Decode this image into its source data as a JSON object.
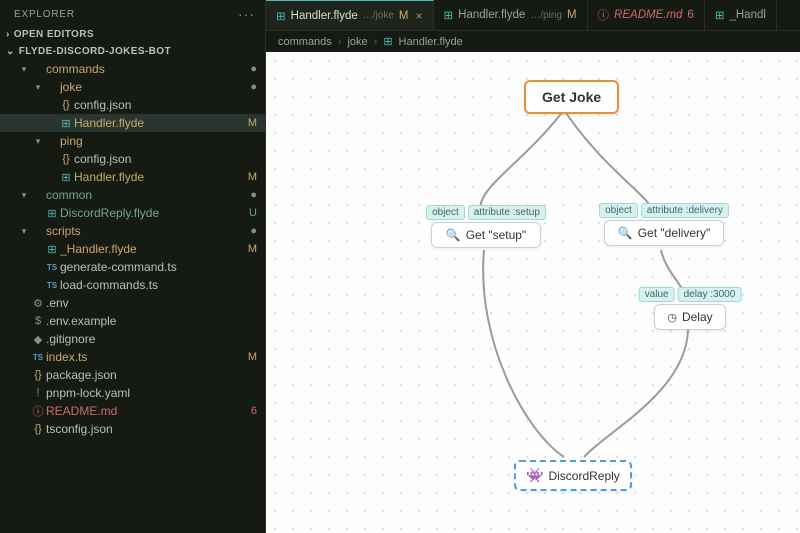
{
  "explorer": {
    "title": "EXPLORER",
    "openEditors": "OPEN EDITORS",
    "project": "FLYDE-DISCORD-JOKES-BOT",
    "tree": [
      {
        "ind": 1,
        "chev": "▾",
        "icon": "",
        "label": "commands",
        "cls": "folder-c",
        "badge": "●",
        "badgeCls": "gray",
        "sel": false
      },
      {
        "ind": 2,
        "chev": "▾",
        "icon": "",
        "label": "joke",
        "cls": "folder-c",
        "badge": "●",
        "badgeCls": "gray",
        "sel": false
      },
      {
        "ind": 3,
        "chev": "",
        "icon": "{}",
        "iconCls": "yellow",
        "label": "config.json",
        "cls": "",
        "badge": "",
        "sel": false
      },
      {
        "ind": 3,
        "chev": "",
        "icon": "⊞",
        "iconCls": "teal",
        "label": "Handler.flyde",
        "cls": "git-m",
        "badge": "M",
        "badgeCls": "git-m",
        "sel": true
      },
      {
        "ind": 2,
        "chev": "▾",
        "icon": "",
        "label": "ping",
        "cls": "folder-c",
        "badge": "",
        "sel": false
      },
      {
        "ind": 3,
        "chev": "",
        "icon": "{}",
        "iconCls": "yellow",
        "label": "config.json",
        "cls": "",
        "badge": "",
        "sel": false
      },
      {
        "ind": 3,
        "chev": "",
        "icon": "⊞",
        "iconCls": "teal",
        "label": "Handler.flyde",
        "cls": "git-m",
        "badge": "M",
        "badgeCls": "git-m",
        "sel": false
      },
      {
        "ind": 1,
        "chev": "▾",
        "icon": "",
        "label": "common",
        "cls": "git-u",
        "badge": "●",
        "badgeCls": "gray",
        "sel": false
      },
      {
        "ind": 2,
        "chev": "",
        "icon": "⊞",
        "iconCls": "teal",
        "label": "DiscordReply.flyde",
        "cls": "git-u",
        "badge": "U",
        "badgeCls": "git-u",
        "sel": false
      },
      {
        "ind": 1,
        "chev": "▾",
        "icon": "",
        "label": "scripts",
        "cls": "folder-c",
        "badge": "●",
        "badgeCls": "gray",
        "sel": false
      },
      {
        "ind": 2,
        "chev": "",
        "icon": "⊞",
        "iconCls": "teal",
        "label": "_Handler.flyde",
        "cls": "git-m",
        "badge": "M",
        "badgeCls": "git-m",
        "sel": false
      },
      {
        "ind": 2,
        "chev": "",
        "icon": "TS",
        "iconCls": "blue",
        "label": "generate-command.ts",
        "cls": "",
        "badge": "",
        "sel": false
      },
      {
        "ind": 2,
        "chev": "",
        "icon": "TS",
        "iconCls": "blue",
        "label": "load-commands.ts",
        "cls": "",
        "badge": "",
        "sel": false
      },
      {
        "ind": 1,
        "chev": "",
        "icon": "⚙",
        "iconCls": "gray",
        "label": ".env",
        "cls": "",
        "badge": "",
        "sel": false
      },
      {
        "ind": 1,
        "chev": "",
        "icon": "$",
        "iconCls": "gray",
        "label": ".env.example",
        "cls": "",
        "badge": "",
        "sel": false
      },
      {
        "ind": 1,
        "chev": "",
        "icon": "◆",
        "iconCls": "gray",
        "label": ".gitignore",
        "cls": "",
        "badge": "",
        "sel": false
      },
      {
        "ind": 1,
        "chev": "",
        "icon": "TS",
        "iconCls": "blue",
        "label": "index.ts",
        "cls": "git-m",
        "badge": "M",
        "badgeCls": "git-m",
        "sel": false
      },
      {
        "ind": 1,
        "chev": "",
        "icon": "{}",
        "iconCls": "yellow",
        "label": "package.json",
        "cls": "",
        "badge": "",
        "sel": false
      },
      {
        "ind": 1,
        "chev": "",
        "icon": "!",
        "iconCls": "gray",
        "label": "pnpm-lock.yaml",
        "cls": "",
        "badge": "",
        "sel": false
      },
      {
        "ind": 1,
        "chev": "",
        "icon": "ⓘ",
        "iconCls": "red",
        "label": "README.md",
        "cls": "git-err",
        "badge": "6",
        "badgeCls": "git-err",
        "sel": false
      },
      {
        "ind": 1,
        "chev": "",
        "icon": "{}",
        "iconCls": "yellow",
        "label": "tsconfig.json",
        "cls": "",
        "badge": "",
        "sel": false
      }
    ]
  },
  "tabs": [
    {
      "icon": "⊞",
      "iconCls": "teal",
      "label": "Handler.flyde",
      "path": "…/joke",
      "badge": "M",
      "badgeCls": "git-m",
      "close": "×",
      "active": true
    },
    {
      "icon": "⊞",
      "iconCls": "teal",
      "label": "Handler.flyde",
      "path": "…/ping",
      "badge": "M",
      "badgeCls": "git-m",
      "close": "",
      "active": false
    },
    {
      "icon": "ⓘ",
      "iconCls": "red",
      "label": "README.md",
      "labelCls": "git-err italic",
      "path": "",
      "badge": "6",
      "badgeCls": "git-err",
      "close": "",
      "active": false
    },
    {
      "icon": "⊞",
      "iconCls": "teal",
      "label": "_Handl",
      "path": "",
      "badge": "",
      "close": "",
      "active": false
    }
  ],
  "breadcrumb": {
    "seg1": "commands",
    "seg2": "joke",
    "seg3": "Handler.flyde",
    "seg3icon": "⊞"
  },
  "nodes": {
    "getJoke": {
      "label": "Get Joke"
    },
    "getSetup": {
      "label": "Get \"setup\"",
      "ports": [
        "object",
        "attribute :setup"
      ],
      "icon": "🔍"
    },
    "getDelivery": {
      "label": "Get \"delivery\"",
      "ports": [
        "object",
        "attribute :delivery"
      ],
      "icon": "🔍"
    },
    "delay": {
      "label": "Delay",
      "ports": [
        "value",
        "delay :3000"
      ],
      "icon": "◷"
    },
    "discordReply": {
      "label": "DiscordReply",
      "icon": "👾"
    }
  }
}
